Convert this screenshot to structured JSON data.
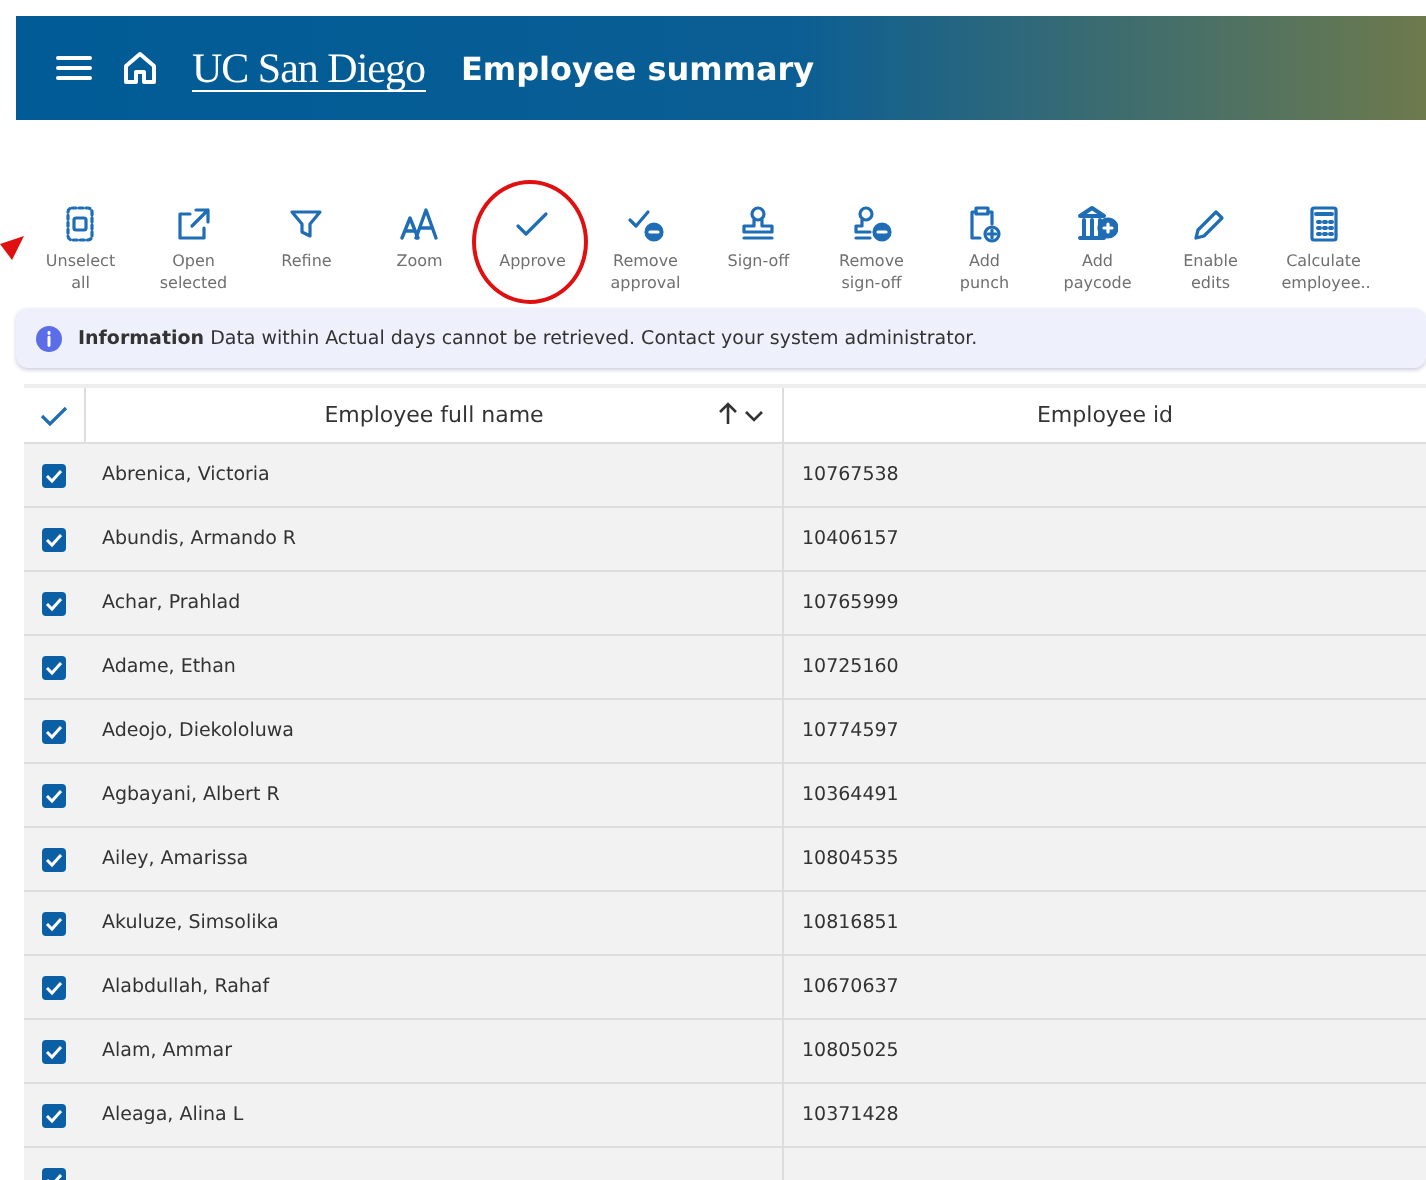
{
  "header": {
    "title": "Employee summary",
    "logo": "UC San Diego"
  },
  "toolbar": [
    {
      "label": "Unselect all",
      "highlighted": false
    },
    {
      "label": "Open selected",
      "highlighted": false
    },
    {
      "label": "Refine",
      "highlighted": false
    },
    {
      "label": "Zoom",
      "highlighted": false
    },
    {
      "label": "Approve",
      "highlighted": true
    },
    {
      "label": "Remove approval",
      "highlighted": false
    },
    {
      "label": "Sign-off",
      "highlighted": false
    },
    {
      "label": "Remove sign-off",
      "highlighted": false
    },
    {
      "label": "Add punch",
      "highlighted": false
    },
    {
      "label": "Add paycode",
      "highlighted": false
    },
    {
      "label": "Enable edits",
      "highlighted": false
    },
    {
      "label": "Calculate employee..",
      "highlighted": false
    }
  ],
  "info": {
    "label": "Information",
    "message": "Data within Actual days cannot be retrieved. Contact your system administrator."
  },
  "table": {
    "columns": [
      "Employee full name",
      "Employee id"
    ],
    "all_checked": true,
    "rows": [
      {
        "name": "Abrenica, Victoria",
        "id": "10767538",
        "checked": true
      },
      {
        "name": "Abundis, Armando R",
        "id": "10406157",
        "checked": true
      },
      {
        "name": "Achar, Prahlad",
        "id": "10765999",
        "checked": true
      },
      {
        "name": "Adame, Ethan",
        "id": "10725160",
        "checked": true
      },
      {
        "name": "Adeojo, Diekololuwa",
        "id": "10774597",
        "checked": true
      },
      {
        "name": "Agbayani, Albert R",
        "id": "10364491",
        "checked": true
      },
      {
        "name": "Ailey, Amarissa",
        "id": "10804535",
        "checked": true
      },
      {
        "name": "Akuluze, Simsolika",
        "id": "10816851",
        "checked": true
      },
      {
        "name": "Alabdullah, Rahaf",
        "id": "10670637",
        "checked": true
      },
      {
        "name": "Alam, Ammar",
        "id": "10805025",
        "checked": true
      },
      {
        "name": "Aleaga, Alina L",
        "id": "10371428",
        "checked": true
      },
      {
        "checked": true
      }
    ]
  }
}
